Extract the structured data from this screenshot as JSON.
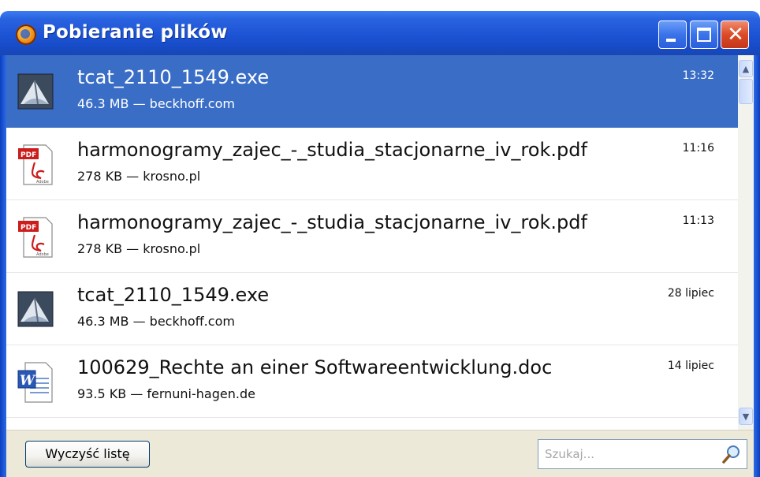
{
  "window": {
    "title": "Pobieranie plików"
  },
  "downloads": [
    {
      "filename": "tcat_2110_1549.exe",
      "meta": "46.3 MB — beckhoff.com",
      "time": "13:32",
      "icon": "exe-setup-icon",
      "selected": true
    },
    {
      "filename": "harmonogramy_zajec_-_studia_stacjonarne_iv_rok.pdf",
      "meta": "278 KB — krosno.pl",
      "time": "11:16",
      "icon": "pdf-icon",
      "selected": false
    },
    {
      "filename": "harmonogramy_zajec_-_studia_stacjonarne_iv_rok.pdf",
      "meta": "278 KB — krosno.pl",
      "time": "11:13",
      "icon": "pdf-icon",
      "selected": false
    },
    {
      "filename": "tcat_2110_1549.exe",
      "meta": "46.3 MB — beckhoff.com",
      "time": "28 lipiec",
      "icon": "exe-setup-icon",
      "selected": false
    },
    {
      "filename": "100629_Rechte an einer Softwareentwicklung.doc",
      "meta": "93.5 KB — fernuni-hagen.de",
      "time": "14 lipiec",
      "icon": "word-doc-icon",
      "selected": false
    }
  ],
  "footer": {
    "clear_label": "Wyczyść listę",
    "search_placeholder": "Szukaj..."
  },
  "colors": {
    "titlebar": "#1e55d6",
    "selection": "#3a6ec6",
    "close_button": "#dc4b27",
    "footer_bg": "#ece9d8"
  }
}
